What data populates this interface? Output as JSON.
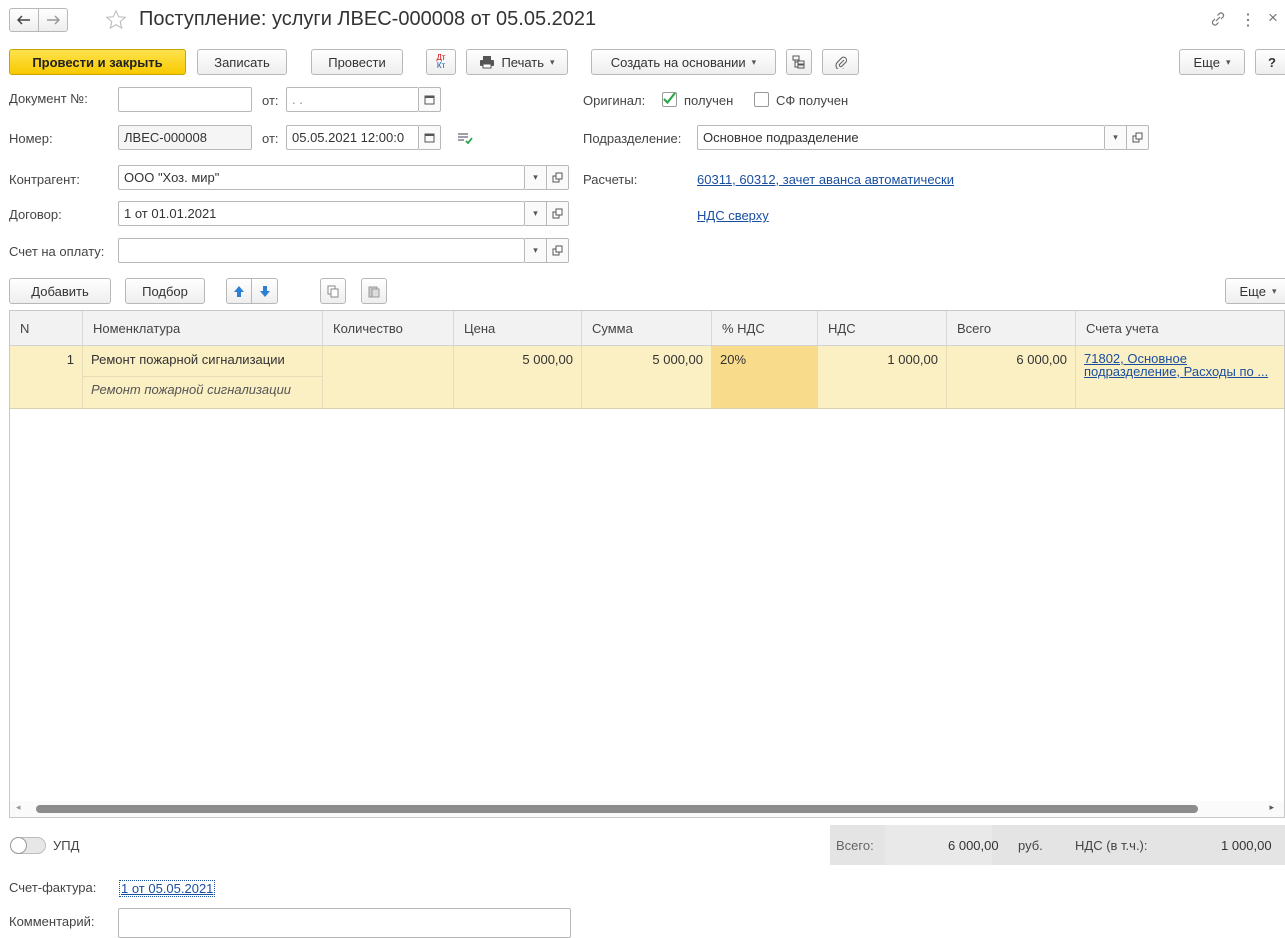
{
  "window": {
    "title": "Поступление: услуги ЛВЕС-000008 от 05.05.2021"
  },
  "toolbar": {
    "post_close": "Провести и закрыть",
    "save": "Записать",
    "post": "Провести",
    "dtkt_top": "Дт",
    "dtkt_bottom": "Кт",
    "print": "Печать",
    "create_based": "Создать на основании",
    "more": "Еще",
    "help": "?"
  },
  "form": {
    "doc_num_label": "Документ №:",
    "doc_num_value": "",
    "from_label": "от:",
    "doc_date_value": " .  .",
    "number_label": "Номер:",
    "number_value": "ЛВЕС-000008",
    "number_date_value": "05.05.2021 12:00:0",
    "original_label": "Оригинал:",
    "received_label": "получен",
    "sf_received_label": "СФ получен",
    "department_label": "Подразделение:",
    "department_value": "Основное подразделение",
    "counterparty_label": "Контрагент:",
    "counterparty_value": "ООО \"Хоз. мир\"",
    "settlements_label": "Расчеты:",
    "settlements_link": "60311, 60312, зачет аванса автоматически",
    "contract_label": "Договор:",
    "contract_value": "1 от 01.01.2021",
    "vat_link": "НДС сверху",
    "invoice_label": "Счет на оплату:",
    "invoice_value": ""
  },
  "table_toolbar": {
    "add": "Добавить",
    "select": "Подбор",
    "more": "Еще"
  },
  "table": {
    "headers": [
      "N",
      "Номенклатура",
      "Количество",
      "Цена",
      "Сумма",
      "% НДС",
      "НДС",
      "Всего",
      "Счета учета"
    ],
    "rows": [
      {
        "n": "1",
        "item": "Ремонт пожарной сигнализации",
        "item_content": "Ремонт пожарной сигнализации",
        "qty": "",
        "price": "5 000,00",
        "sum": "5 000,00",
        "vat_rate": "20%",
        "vat": "1 000,00",
        "total": "6 000,00",
        "accounts_line1": "71802, Основное",
        "accounts_line2": "подразделение, Расходы по ..."
      }
    ]
  },
  "footer": {
    "upd_label": "УПД",
    "total_label": "Всего:",
    "total_value": "6 000,00",
    "currency": "руб.",
    "vat_label": "НДС (в т.ч.):",
    "vat_value": "1 000,00",
    "invoice_label": "Счет-фактура:",
    "invoice_link": "1 от 05.05.2021",
    "comment_label": "Комментарий:",
    "comment_value": ""
  }
}
